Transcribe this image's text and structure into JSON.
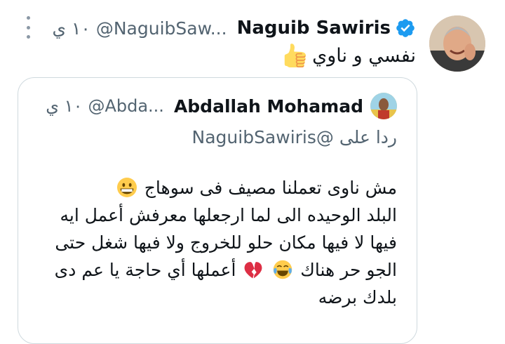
{
  "tweet": {
    "author_name": "Naguib Sawiris",
    "author_handle": "@NaguibSaw...",
    "time": "١٠ ي",
    "text": "نفسي و ناوي"
  },
  "quote": {
    "author_name": "Abdallah Mohamad",
    "author_handle": "@Abda...",
    "time": "١٠ ي",
    "reply_prefix": "ردا على",
    "reply_mention": "@NaguibSawiris",
    "lines": {
      "l1": "مش ناوى تعملنا مصيف فى سوهاج",
      "l2": "البلد الوحيده الى لما ارجعلها معرفش أعمل ايه",
      "l3": "فيها  لا فيها مكان حلو للخروج ولا فيها شغل حتى",
      "l4a": "الجو حر هناك",
      "l4b": "أعملها أي حاجة يا عم دى",
      "l5": "بلدك برضه"
    }
  },
  "icons": {
    "verified": "verified-badge-icon",
    "more": "more-options-icon",
    "thumbs_up": "thumbs-up-emoji",
    "grin": "grinning-face-emoji",
    "broken_heart": "broken-heart-emoji",
    "tears_of_joy": "tears-of-joy-emoji"
  },
  "colors": {
    "verified_blue": "#1d9bf0",
    "secondary_text": "#536471",
    "border": "#cfd9de"
  }
}
